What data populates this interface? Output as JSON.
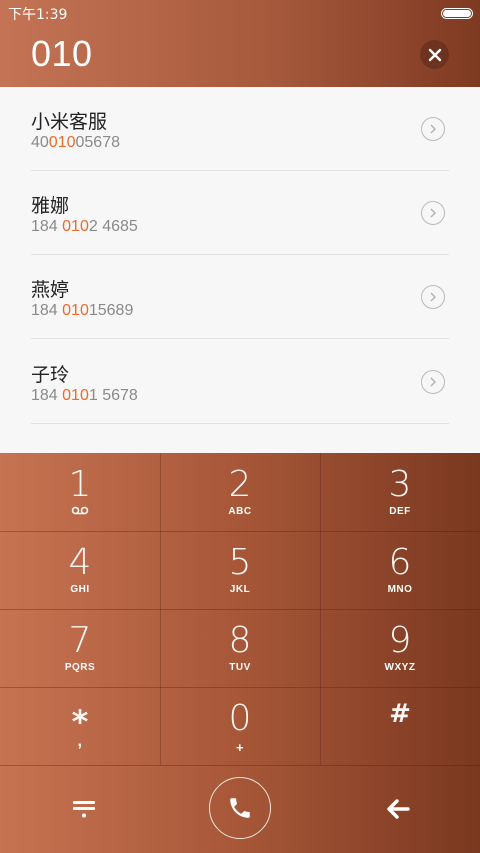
{
  "status_bar": {
    "time": "下午1:39"
  },
  "dialer": {
    "input": "010"
  },
  "contacts": [
    {
      "name": "小米客服",
      "num_pre": "40",
      "num_hl": "010",
      "num_post": "05678"
    },
    {
      "name": "雅娜",
      "num_pre": "184 ",
      "num_hl": "010",
      "num_post": "2 4685"
    },
    {
      "name": "燕婷",
      "num_pre": "184 ",
      "num_hl": "010",
      "num_post": "15689"
    },
    {
      "name": "子玲",
      "num_pre": "184 ",
      "num_hl": "010",
      "num_post": "1 5678"
    }
  ],
  "keypad": [
    {
      "digit": "1",
      "letters": ""
    },
    {
      "digit": "2",
      "letters": "ABC"
    },
    {
      "digit": "3",
      "letters": "DEF"
    },
    {
      "digit": "4",
      "letters": "GHI"
    },
    {
      "digit": "5",
      "letters": "JKL"
    },
    {
      "digit": "6",
      "letters": "MNO"
    },
    {
      "digit": "7",
      "letters": "PQRS"
    },
    {
      "digit": "8",
      "letters": "TUV"
    },
    {
      "digit": "9",
      "letters": "WXYZ"
    },
    {
      "digit": "*",
      "letters": ","
    },
    {
      "digit": "0",
      "letters": "+"
    },
    {
      "digit": "#",
      "letters": ""
    }
  ],
  "colors": {
    "highlight": "#ec6a2a",
    "accent": "#a85a3d"
  }
}
